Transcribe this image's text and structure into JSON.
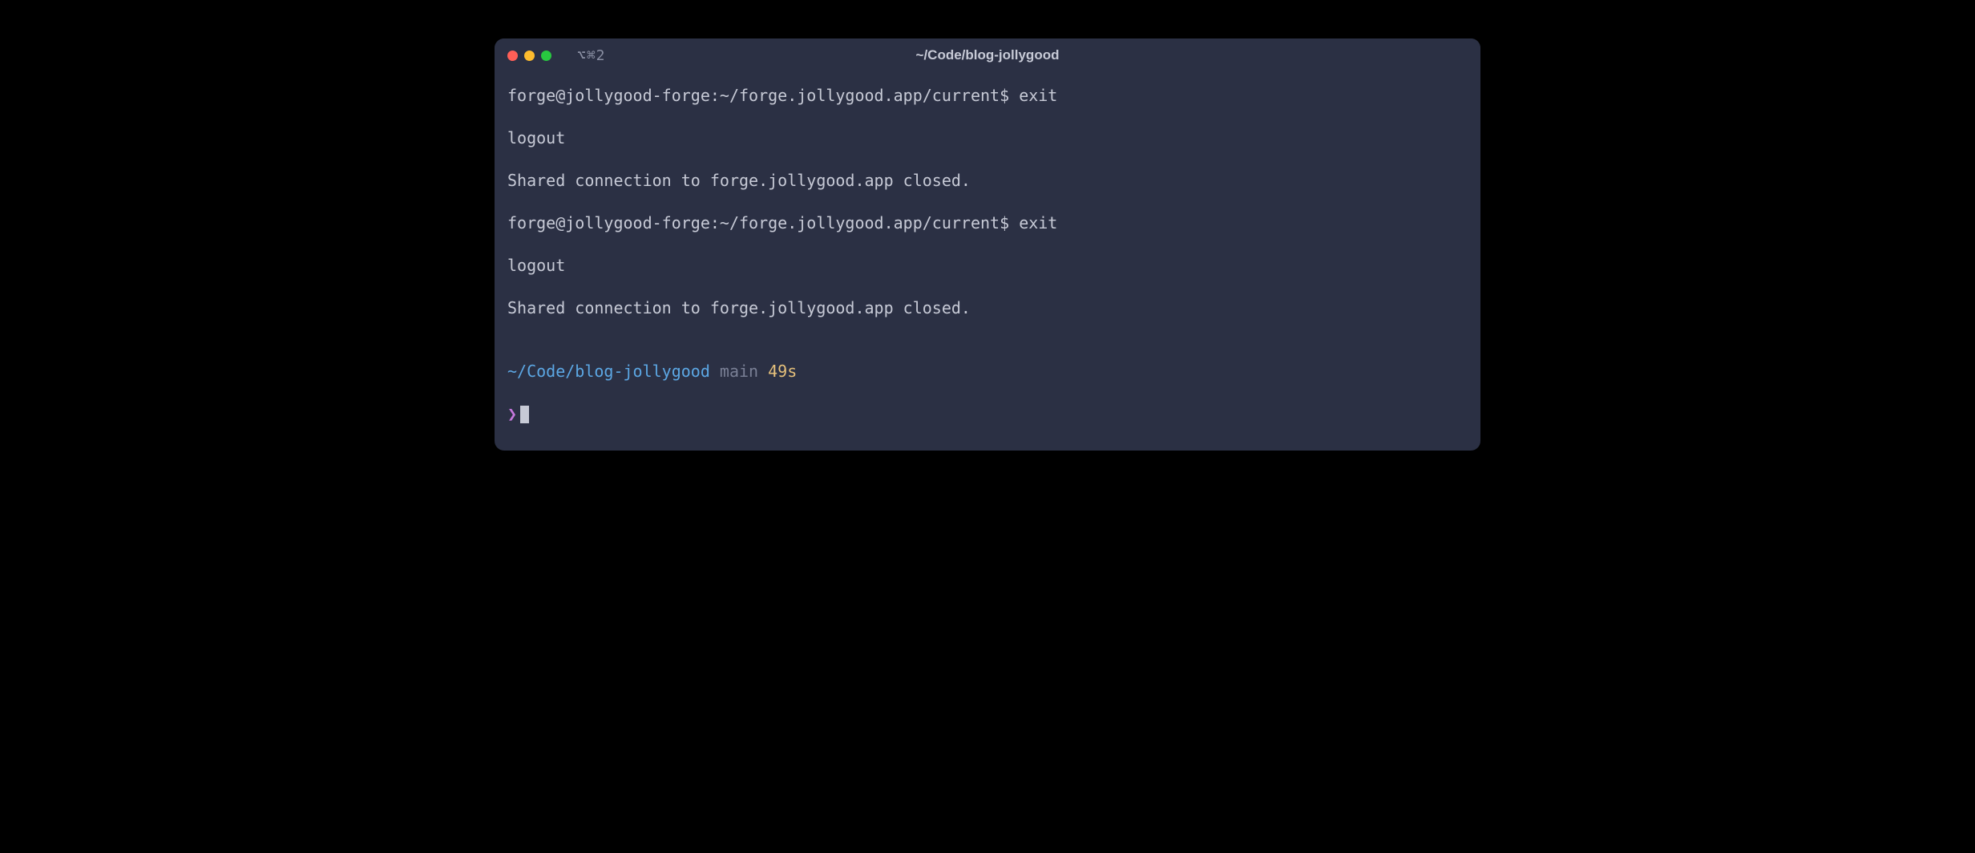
{
  "window": {
    "tab_indicator": "⌥⌘2",
    "title": "~/Code/blog-jollygood"
  },
  "lines": {
    "l1_prompt": "forge@jollygood-forge:~/forge.jollygood.app/current$ ",
    "l1_cmd": "exit",
    "l2": "logout",
    "l3": "Shared connection to forge.jollygood.app closed.",
    "l4_prompt": "forge@jollygood-forge:~/forge.jollygood.app/current$ ",
    "l4_cmd": "exit",
    "l5": "logout",
    "l6": "Shared connection to forge.jollygood.app closed."
  },
  "prompt": {
    "path": "~/Code/blog-jollygood",
    "branch": "main",
    "time": "49s",
    "symbol": "❯"
  }
}
